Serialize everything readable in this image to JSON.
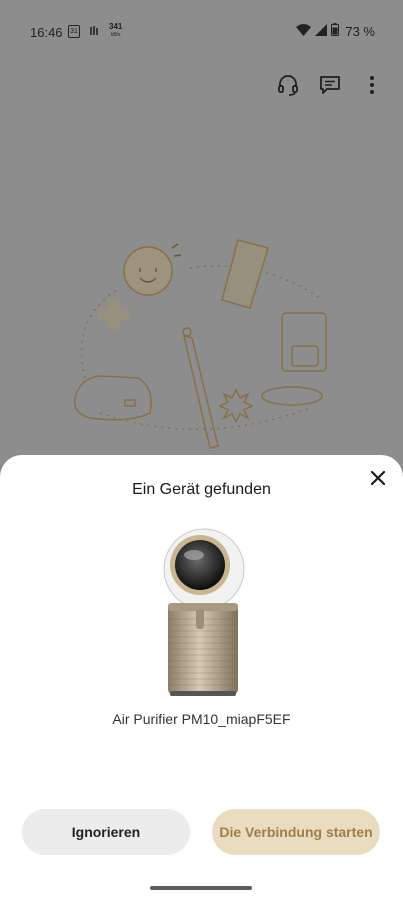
{
  "status_bar": {
    "time": "16:46",
    "calendar_day": "31",
    "net_speed_value": "341",
    "net_speed_unit": "kB/s",
    "battery_pct": "73 %"
  },
  "top_actions": {
    "icons": [
      "headset-icon",
      "feedback-icon",
      "more-vert-icon"
    ]
  },
  "sheet": {
    "title": "Ein Gerät gefunden",
    "device_name": "Air Purifier PM10_miapF5EF",
    "ignore_label": "Ignorieren",
    "connect_label": "Die Verbindung starten"
  },
  "colors": {
    "accent_bg": "#eadcc1",
    "accent_text": "#a07d4b",
    "scrim": "#8d8d8d"
  }
}
